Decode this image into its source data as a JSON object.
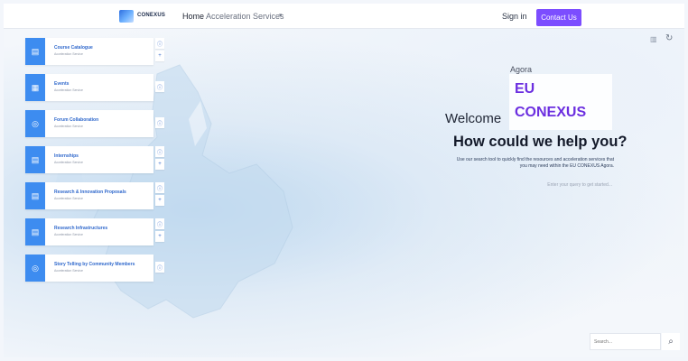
{
  "header": {
    "logo_text": "CONEXUS",
    "nav_home": "Home",
    "nav_acceleration": "Acceleration Services",
    "sign_in": "Sign in",
    "contact_us": "Contact Us"
  },
  "sidebar": {
    "items": [
      {
        "title": "Course Catalogue",
        "subtitle": "Acceleration Service",
        "icon": "catalog-icon",
        "buttons": [
          "info",
          "add"
        ]
      },
      {
        "title": "Events",
        "subtitle": "Acceleration Service",
        "icon": "calendar-icon",
        "buttons": [
          "info"
        ]
      },
      {
        "title": "Forum Collaboration",
        "subtitle": "Acceleration Service",
        "icon": "forum-icon",
        "buttons": [
          "info"
        ]
      },
      {
        "title": "Internships",
        "subtitle": "Acceleration Service",
        "icon": "internship-icon",
        "buttons": [
          "info",
          "add"
        ]
      },
      {
        "title": "Research & Innovation Proposals",
        "subtitle": "Acceleration Service",
        "icon": "research-icon",
        "buttons": [
          "info",
          "add"
        ]
      },
      {
        "title": "Research Infrastructures",
        "subtitle": "Acceleration Service",
        "icon": "infrastructure-icon",
        "buttons": [
          "info",
          "add"
        ]
      },
      {
        "title": "Story Telling by Community Members",
        "subtitle": "Acceleration Service",
        "icon": "story-icon",
        "buttons": [
          "info"
        ]
      }
    ]
  },
  "hero": {
    "agora": "Agora",
    "welcome": "Welcome",
    "eu": "EU",
    "conexus": "CONEXUS",
    "headline": "How could we help you?",
    "description": "Use our search tool to quickly find the resources and acceleration services that you may need within the EU CONEXUS Agora.",
    "query_hint": "Enter your query to get started..."
  },
  "search": {
    "placeholder": "Search..."
  },
  "icons": {
    "book": "book-icon",
    "refresh": "refresh-icon",
    "search": "search-icon"
  },
  "colors": {
    "accent": "#7c4dff",
    "brand_purple": "#6c2fe0",
    "card_icon_bg": "#3d8cf0",
    "card_title": "#2f68cc"
  }
}
